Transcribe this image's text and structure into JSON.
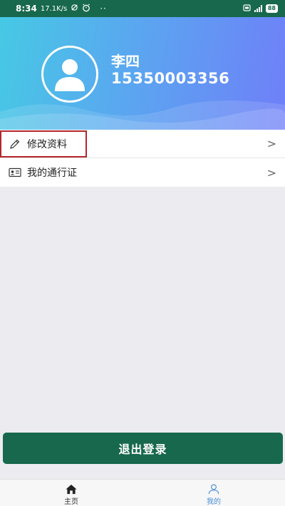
{
  "status_bar": {
    "time": "8:34",
    "speed": "17.1K/s",
    "dots": "··",
    "battery": "88"
  },
  "profile": {
    "name": "李四",
    "phone": "15350003356"
  },
  "menu": {
    "items": [
      {
        "label": "修改资料",
        "icon": "pencil-icon"
      },
      {
        "label": "我的通行证",
        "icon": "id-card-icon"
      }
    ],
    "arrow": ">"
  },
  "logout_label": "退出登录",
  "tabbar": {
    "tabs": [
      {
        "label": "主页",
        "icon": "home-icon"
      },
      {
        "label": "我的",
        "icon": "person-icon"
      }
    ]
  },
  "colors": {
    "primary": "#17684d",
    "highlight": "#b5262b",
    "tab_active": "#4a8fd8"
  }
}
